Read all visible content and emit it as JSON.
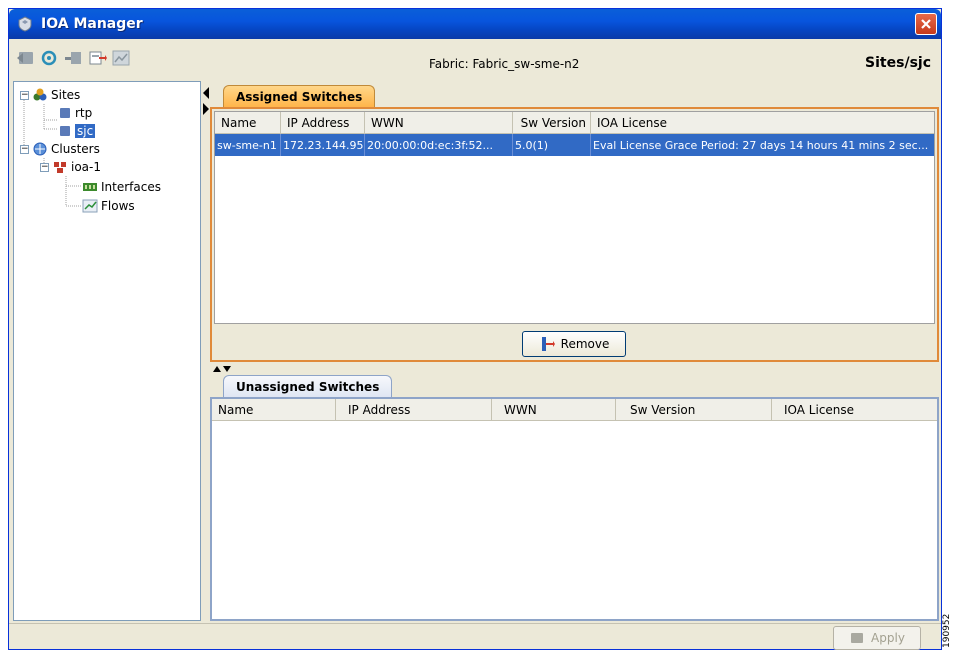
{
  "window": {
    "title": "IOA Manager"
  },
  "toolbar": {
    "fabric_label": "Fabric: Fabric_sw-sme-n2",
    "site_path": "Sites/sjc",
    "icons": [
      "back-icon",
      "refresh-icon",
      "add-icon",
      "export-icon",
      "chart-icon"
    ]
  },
  "tree": {
    "sites": "Sites",
    "rtp": "rtp",
    "sjc": "sjc",
    "clusters": "Clusters",
    "ioa1": "ioa-1",
    "interfaces": "Interfaces",
    "flows": "Flows"
  },
  "assigned": {
    "tab_label": "Assigned Switches",
    "columns": [
      "Name",
      "IP Address",
      "WWN",
      "Sw Version",
      "IOA License"
    ],
    "rows": [
      [
        "sw-sme-n1",
        "172.23.144.95",
        "20:00:00:0d:ec:3f:52...",
        "5.0(1)",
        "Eval License Grace Period: 27 days 14 hours 41 mins 2 sec..."
      ]
    ],
    "remove_label": "Remove"
  },
  "unassigned": {
    "tab_label": "Unassigned Switches",
    "columns": [
      "Name",
      "IP Address",
      "WWN",
      "Sw Version",
      "IOA License"
    ]
  },
  "footer": {
    "apply_label": "Apply"
  },
  "figure_id": "190952",
  "colors": {
    "accent": "#316ac5",
    "tab_active": "#ffb54a",
    "titlebar": "#0855dd"
  }
}
